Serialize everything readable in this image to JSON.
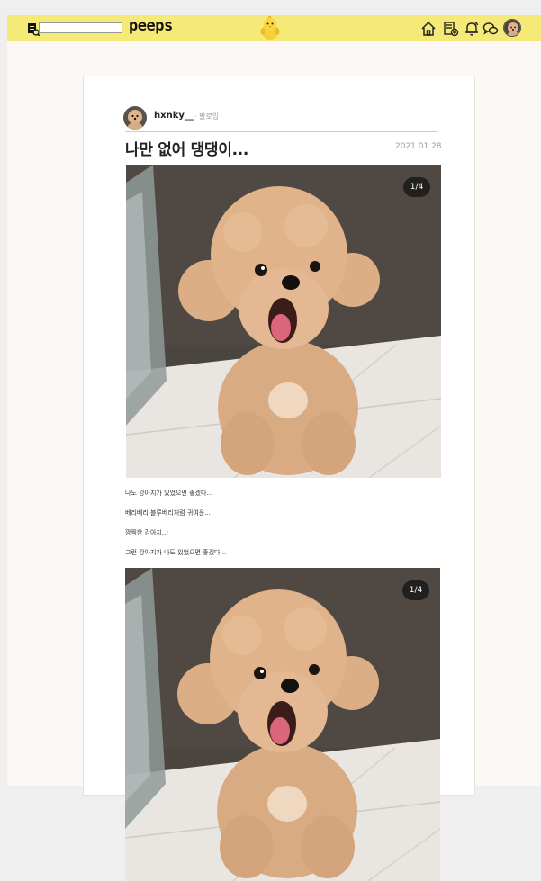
{
  "debug_label": "#F5E978",
  "header": {
    "brand": "peeps",
    "search": {
      "value": "",
      "placeholder": ""
    },
    "nav_icons": [
      "home-icon",
      "new-post-icon",
      "bell-icon",
      "chat-icon",
      "profile-avatar"
    ]
  },
  "post": {
    "author": "hxnky__",
    "follow_label": "· 팔로잉",
    "title": "나만 없어 댕댕이...",
    "date": "2021.01.28",
    "photos": [
      {
        "counter": "1/4"
      },
      {
        "counter": "1/4"
      }
    ],
    "caption_lines": [
      "나도 강아지가 있었으면 좋겠다...",
      "베리베리 블루베리처럼 귀여운...",
      "깜찍한 강아지..!",
      "그런 강아지가 나도 있었으면 좋겠다..."
    ]
  },
  "colors": {
    "header_bg": "#F5E978",
    "page_bg": "#FBF8F5",
    "card_bg": "#FFFFFF"
  }
}
